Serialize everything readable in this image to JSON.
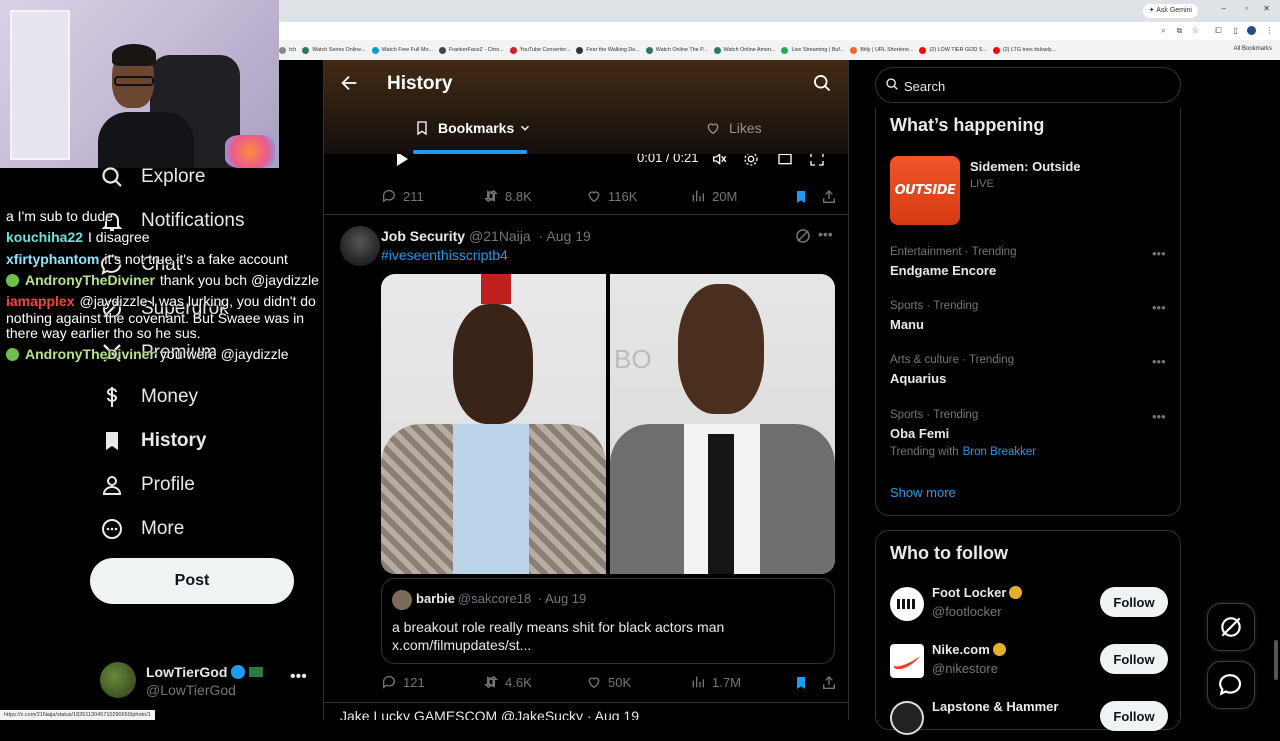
{
  "browser": {
    "ask_gemini": "Ask Gemini",
    "bookmarks": [
      {
        "label": "tch",
        "color": "#888888"
      },
      {
        "label": "Watch Series Online...",
        "color": "#2a7a5a"
      },
      {
        "label": "Watch Free Full Mo...",
        "color": "#00a0d0"
      },
      {
        "label": "FrankerFaceZ - Chro...",
        "color": "#444444"
      },
      {
        "label": "YouTube Converter...",
        "color": "#cc2222"
      },
      {
        "label": "Fear the Walking De...",
        "color": "#333333"
      },
      {
        "label": "Watch Online The P...",
        "color": "#2a7a5a"
      },
      {
        "label": "Watch Online Ameri...",
        "color": "#2a7a5a"
      },
      {
        "label": "Live Streaming | Buf...",
        "color": "#22aa55"
      },
      {
        "label": "Bitly | URL Shortene...",
        "color": "#ee6622"
      },
      {
        "label": "(2) LOW TIER GOD S...",
        "color": "#ff0000"
      },
      {
        "label": "(2) LTG tries itslowly...",
        "color": "#ff0000"
      }
    ],
    "all_bookmarks": "All Bookmarks",
    "status_url": "https://x.com/21Naija/status/1826113045710290650/photo/1"
  },
  "chat": [
    {
      "user": "",
      "text": "a  I'm sub to dude",
      "color": "#ffffff",
      "badge": false
    },
    {
      "user": "kouchiha22",
      "text": "I disagree",
      "color": "#6ee0e0",
      "badge": false
    },
    {
      "user": "xfirtyphantom",
      "text": "it's not true it's a fake account",
      "color": "#8fe3ff",
      "badge": false
    },
    {
      "user": "AndronyTheDiviner",
      "text": "thank you bch @jaydizzle",
      "color": "#b7e38a",
      "badge": true
    },
    {
      "user": "iamapplex",
      "text": "@jaydizzle I was lurking, you didn't do",
      "color": "#ff4040",
      "badge": false
    },
    {
      "user": "",
      "text": "nothing against the covenant. But Swaee was in",
      "color": "#ffffff",
      "badge": false
    },
    {
      "user": "",
      "text": "there way earlier tho so he sus.",
      "color": "#ffffff",
      "badge": false
    },
    {
      "user": "AndronyTheDiviner",
      "text": "you were @jaydizzle",
      "color": "#b7e38a",
      "badge": true
    }
  ],
  "nav": {
    "items": [
      {
        "label": "Explore",
        "icon": "search-icon"
      },
      {
        "label": "Notifications",
        "icon": "bell-icon"
      },
      {
        "label": "Chat",
        "icon": "chat-icon"
      },
      {
        "label": "Supergrok",
        "icon": "grok-icon"
      },
      {
        "label": "Premium",
        "icon": "x-icon"
      },
      {
        "label": "Money",
        "icon": "dollar-icon"
      },
      {
        "label": "History",
        "icon": "bookmark-icon",
        "active": true
      },
      {
        "label": "Profile",
        "icon": "person-icon"
      },
      {
        "label": "More",
        "icon": "more-circle-icon"
      }
    ],
    "post_label": "Post"
  },
  "account": {
    "name": "LowTierGod",
    "handle": "@LowTierGod"
  },
  "main": {
    "title": "History",
    "tabs": [
      {
        "label": "Bookmarks",
        "active": true
      },
      {
        "label": "Likes",
        "active": false
      }
    ],
    "video_time": "0:01 / 0:21",
    "prev_tweet_stats": {
      "replies": "211",
      "reposts": "8.8K",
      "likes": "116K",
      "views": "20M"
    },
    "tweet": {
      "name": "Job Security",
      "handle": "@21Naija",
      "date": "· Aug 19",
      "hashtag": "#iveseenthisscriptb4",
      "quote": {
        "name": "barbie",
        "handle": "@sakcore18",
        "date": "· Aug 19",
        "text": "a breakout role really means shit for black actors man x.com/filmupdates/st..."
      },
      "stats": {
        "replies": "121",
        "reposts": "4.6K",
        "likes": "50K",
        "views": "1.7M"
      }
    },
    "next_tweet": "Jake Lucky  GAMESCOM  @JakeSucky · Aug 19"
  },
  "right": {
    "search_placeholder": "Search",
    "whats_happening": "What’s happening",
    "featured": {
      "title": "Sidemen: Outside",
      "status": "LIVE",
      "image_text": "OUTSIDE"
    },
    "trends": [
      {
        "context": "Entertainment · Trending",
        "name": "Endgame Encore"
      },
      {
        "context": "Sports · Trending",
        "name": "Manu"
      },
      {
        "context": "Arts & culture · Trending",
        "name": "Aquarius"
      },
      {
        "context": "Sports · Trending",
        "name": "Oba Femi",
        "with_label": "Trending with",
        "with_value": "Bron Breakker"
      }
    ],
    "show_more": "Show more",
    "who_to_follow": "Who to follow",
    "follow": [
      {
        "name": "Foot Locker",
        "handle": "@footlocker",
        "button": "Follow"
      },
      {
        "name": "Nike.com",
        "handle": "@nikestore",
        "button": "Follow"
      },
      {
        "name": "Lapstone & Hammer",
        "handle": "",
        "button": "Follow"
      }
    ]
  },
  "colors": {
    "accent": "#1d9bf0",
    "bg": "#000000",
    "text": "#e7e9ea",
    "muted": "#71767b"
  }
}
